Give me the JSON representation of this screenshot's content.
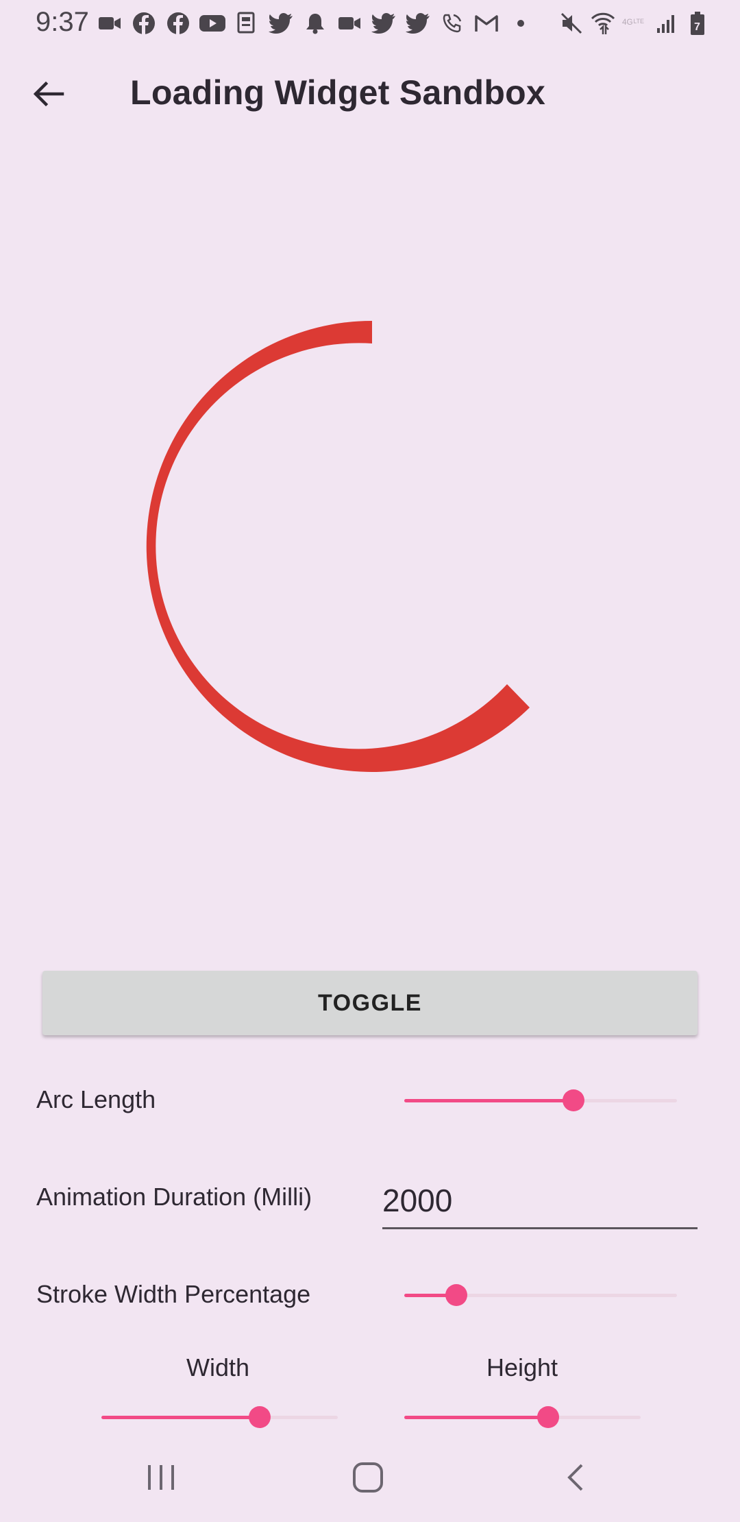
{
  "status_bar": {
    "time": "9:37",
    "notification_icons": [
      "video-icon",
      "facebook-icon",
      "facebook-icon",
      "youtube-icon",
      "news-icon",
      "twitter-icon",
      "bell-icon",
      "video-icon",
      "twitter-icon",
      "twitter-icon",
      "wifi-call-icon",
      "gmail-icon",
      "dot-icon"
    ],
    "system_icons": [
      "mute-icon",
      "wifi-icon",
      "lte-icon",
      "signal-icon",
      "battery-icon"
    ]
  },
  "app_bar": {
    "back_icon": "arrow-left-icon",
    "title": "Loading Widget Sandbox"
  },
  "loader": {
    "color": "#dc3a34"
  },
  "toggle_button": {
    "label": "TOGGLE"
  },
  "arc_length": {
    "label": "Arc Length",
    "value": 0.62
  },
  "animation_duration": {
    "label": "Animation Duration (Milli)",
    "value": "2000"
  },
  "stroke_width": {
    "label": "Stroke Width Percentage",
    "value": 0.19
  },
  "width": {
    "label": "Width",
    "value": 0.67
  },
  "height": {
    "label": "Height",
    "value": 0.61
  },
  "accent_color": "#f24a86",
  "nav_bar": {
    "recents_icon": "recents-icon",
    "home_icon": "home-icon",
    "back_icon": "chevron-left-icon"
  }
}
